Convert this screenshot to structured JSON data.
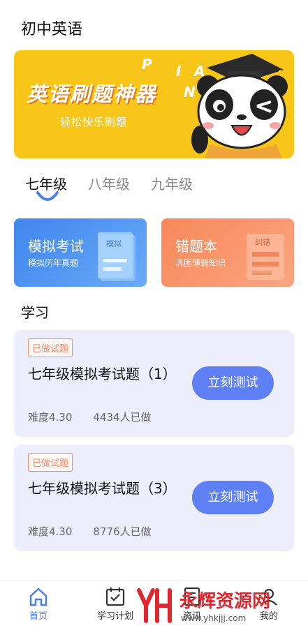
{
  "header": {
    "title": "初中英语"
  },
  "banner": {
    "title": "英语刷题神器",
    "subtitle": "轻松快乐刷题",
    "letters": [
      "P",
      "I",
      "A",
      "N"
    ]
  },
  "grade_tabs": [
    {
      "label": "七年级",
      "active": true
    },
    {
      "label": "八年级",
      "active": false
    },
    {
      "label": "九年级",
      "active": false
    }
  ],
  "features": [
    {
      "title": "模拟考试",
      "subtitle": "模拟历年真题",
      "deco_label": "模拟",
      "color": "#4a8ef2"
    },
    {
      "title": "错题本",
      "subtitle": "巩固薄弱知识",
      "deco_label": "纠错",
      "color": "#f98e61"
    }
  ],
  "section": {
    "title": "学习"
  },
  "study_cards": [
    {
      "badge": "已做试题",
      "title": "七年级模拟考试题（1）",
      "difficulty": "难度4.30",
      "done_count": "4434人已做",
      "button": "立刻测试"
    },
    {
      "badge": "已做试题",
      "title": "七年级模拟考试题（3）",
      "difficulty": "难度4.30",
      "done_count": "8776人已做",
      "button": "立刻测试"
    }
  ],
  "bottom_nav": [
    {
      "label": "首页",
      "icon": "home-icon",
      "active": true
    },
    {
      "label": "学习计划",
      "icon": "calendar-check-icon",
      "active": false
    },
    {
      "label": "资讯",
      "icon": "news-icon",
      "active": false
    },
    {
      "label": "我的",
      "icon": "profile-icon",
      "active": false
    }
  ],
  "watermark": {
    "text": "永辉资源网",
    "url": "www.yhkjjj.com"
  },
  "colors": {
    "accent": "#5f7ff5",
    "banner": "#f8c619",
    "badge": "#f08a6c",
    "card_bg": "#eceffb",
    "nav_active": "#4a7ee8"
  }
}
